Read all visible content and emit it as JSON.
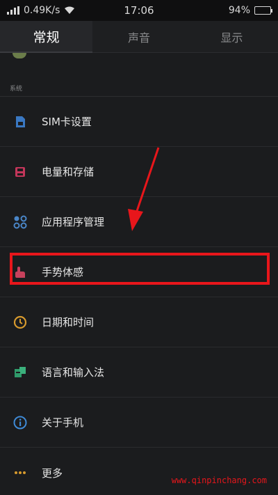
{
  "status": {
    "speed": "0.49K/s",
    "time": "17:06",
    "battery": "94%",
    "battery_level": 0.94
  },
  "tabs": [
    {
      "label": "常规",
      "active": true
    },
    {
      "label": "声音",
      "active": false
    },
    {
      "label": "显示",
      "active": false
    }
  ],
  "section": {
    "title": "系统"
  },
  "items": [
    {
      "label": "SIM卡设置",
      "icon": "sim-card-icon",
      "color": "#3a78c2"
    },
    {
      "label": "电量和存储",
      "icon": "storage-icon",
      "color": "#c2365a"
    },
    {
      "label": "应用程序管理",
      "icon": "apps-icon",
      "color": "#4a86c8"
    },
    {
      "label": "手势体感",
      "icon": "gesture-icon",
      "color": "#c7415c"
    },
    {
      "label": "日期和时间",
      "icon": "clock-icon",
      "color": "#d79a2e"
    },
    {
      "label": "语言和输入法",
      "icon": "language-icon",
      "color": "#2f9a6a"
    },
    {
      "label": "关于手机",
      "icon": "info-icon",
      "color": "#3f8ad6"
    },
    {
      "label": "更多",
      "icon": "more-icon",
      "color": "#d79a2e"
    }
  ],
  "watermark": "www.qinpinchang.com",
  "colors": {
    "highlight": "#e8161b",
    "background": "#1b1c1e"
  }
}
